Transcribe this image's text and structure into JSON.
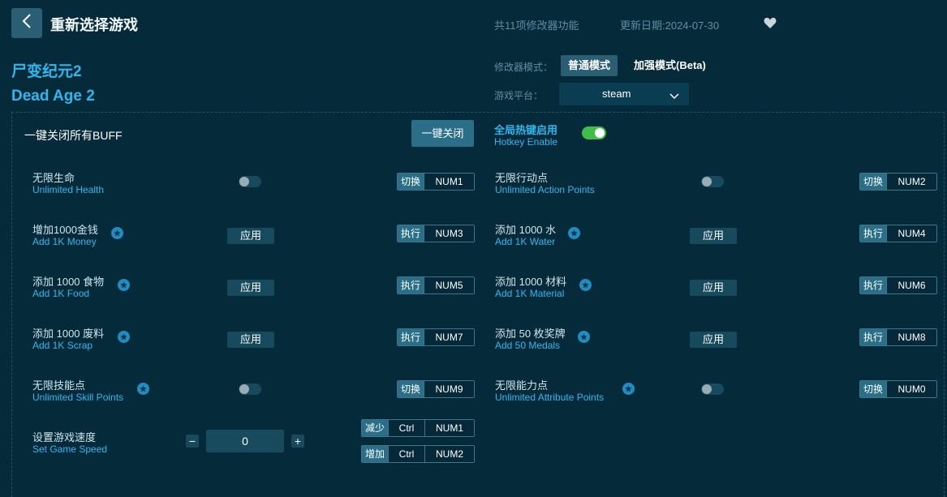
{
  "header": {
    "title": "重新选择游戏",
    "feature_count": "共11项修改器功能",
    "update_date": "更新日期:2024-07-30"
  },
  "game": {
    "name_cn": "尸变纪元2",
    "name_en": "Dead Age 2"
  },
  "mode": {
    "label": "修改器模式：",
    "normal": "普通模式",
    "enhanced": "加强模式(Beta)",
    "active": "normal"
  },
  "platform": {
    "label": "游戏平台：",
    "value": "steam"
  },
  "global": {
    "buff_label": "一键关闭所有BUFF",
    "close_all_label": "一键关闭",
    "hotkey_cn": "全局热键启用",
    "hotkey_en": "Hotkey Enable",
    "hotkey_enabled": true
  },
  "features": [
    {
      "cn": "无限生命",
      "en": "Unlimited Health",
      "star": false,
      "control": "toggle",
      "action": "切换",
      "key": "NUM1",
      "on": false
    },
    {
      "cn": "无限行动点",
      "en": "Unlimited Action Points",
      "star": false,
      "control": "toggle",
      "action": "切换",
      "key": "NUM2",
      "on": false
    },
    {
      "cn": "增加1000金钱",
      "en": "Add 1K Money",
      "star": true,
      "control": "apply",
      "apply_label": "应用",
      "action": "执行",
      "key": "NUM3"
    },
    {
      "cn": "添加 1000 水",
      "en": "Add 1K Water",
      "star": true,
      "control": "apply",
      "apply_label": "应用",
      "action": "执行",
      "key": "NUM4"
    },
    {
      "cn": "添加 1000 食物",
      "en": "Add 1K Food",
      "star": true,
      "control": "apply",
      "apply_label": "应用",
      "action": "执行",
      "key": "NUM5"
    },
    {
      "cn": "添加 1000 材料",
      "en": "Add 1K Material",
      "star": true,
      "control": "apply",
      "apply_label": "应用",
      "action": "执行",
      "key": "NUM6"
    },
    {
      "cn": "添加 1000 废料",
      "en": "Add 1K Scrap",
      "star": true,
      "control": "apply",
      "apply_label": "应用",
      "action": "执行",
      "key": "NUM7"
    },
    {
      "cn": "添加 50 枚奖牌",
      "en": "Add 50 Medals",
      "star": true,
      "control": "apply",
      "apply_label": "应用",
      "action": "执行",
      "key": "NUM8"
    },
    {
      "cn": "无限技能点",
      "en": "Unlimited Skill Points",
      "star": true,
      "control": "toggle",
      "action": "切换",
      "key": "NUM9",
      "on": false
    },
    {
      "cn": "无限能力点",
      "en": "Unlimited Attribute Points",
      "star": true,
      "control": "toggle",
      "action": "切换",
      "key": "NUM0",
      "on": false
    }
  ],
  "speed": {
    "cn": "设置游戏速度",
    "en": "Set Game Speed",
    "minus": "−",
    "plus": "+",
    "value": "0",
    "decrease": {
      "action": "减少",
      "mod": "Ctrl",
      "key": "NUM1"
    },
    "increase": {
      "action": "增加",
      "mod": "Ctrl",
      "key": "NUM2"
    }
  },
  "colors": {
    "background": "#052a3a",
    "accent": "#2fb8ee",
    "button": "#2a6f87",
    "toggle_on": "#3fbf4a"
  }
}
